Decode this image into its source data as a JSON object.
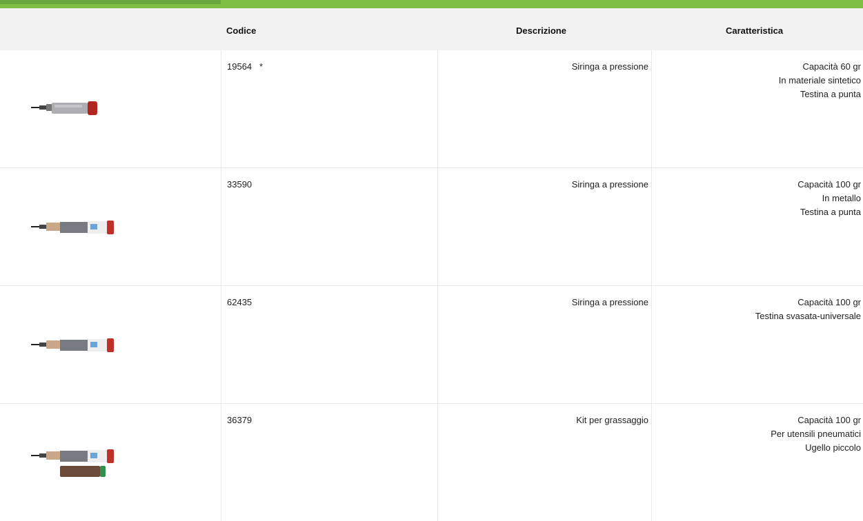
{
  "colors": {
    "accent": "#7fbf44",
    "header_bg": "#f2f2f2"
  },
  "table": {
    "headers": {
      "code": "Codice",
      "description": "Descrizione",
      "feature": "Caratteristica"
    },
    "rows": [
      {
        "code": "19564   *",
        "description": "Siringa a pressione",
        "features": [
          "Capacità 60 gr",
          "In materiale sintetico",
          "Testina a punta"
        ],
        "image": "grease-syringe-clear-icon"
      },
      {
        "code": "33590",
        "description": "Siringa a pressione",
        "features": [
          "Capacità 100 gr",
          "In metallo",
          "Testina a punta"
        ],
        "image": "grease-syringe-metal-icon"
      },
      {
        "code": "62435",
        "description": "Siringa a pressione",
        "features": [
          "Capacità 100 gr",
          "Testina svasata-universale"
        ],
        "image": "grease-syringe-metal-icon"
      },
      {
        "code": "36379",
        "description": "Kit per grassaggio",
        "features": [
          "Capacità 100 gr",
          "Per utensili pneumatici",
          "Ugello piccolo"
        ],
        "image": "grease-kit-icon"
      }
    ]
  }
}
